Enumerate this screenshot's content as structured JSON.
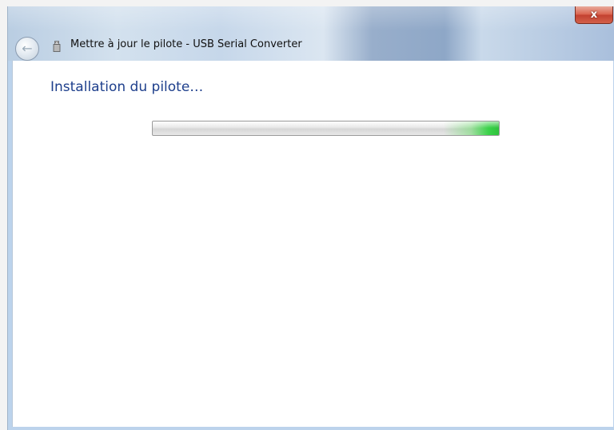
{
  "window": {
    "title": "Mettre à jour le pilote - USB Serial Converter",
    "close_label": "x"
  },
  "back_button": {
    "icon": "back-arrow-icon"
  },
  "title_icon": {
    "icon": "usb-device-icon"
  },
  "content": {
    "heading": "Installation du pilote…"
  },
  "progress": {
    "type": "indeterminate-marquee",
    "accent_color": "#2fc23d"
  },
  "colors": {
    "heading": "#1e3f8c",
    "close_button": "#c24030"
  }
}
